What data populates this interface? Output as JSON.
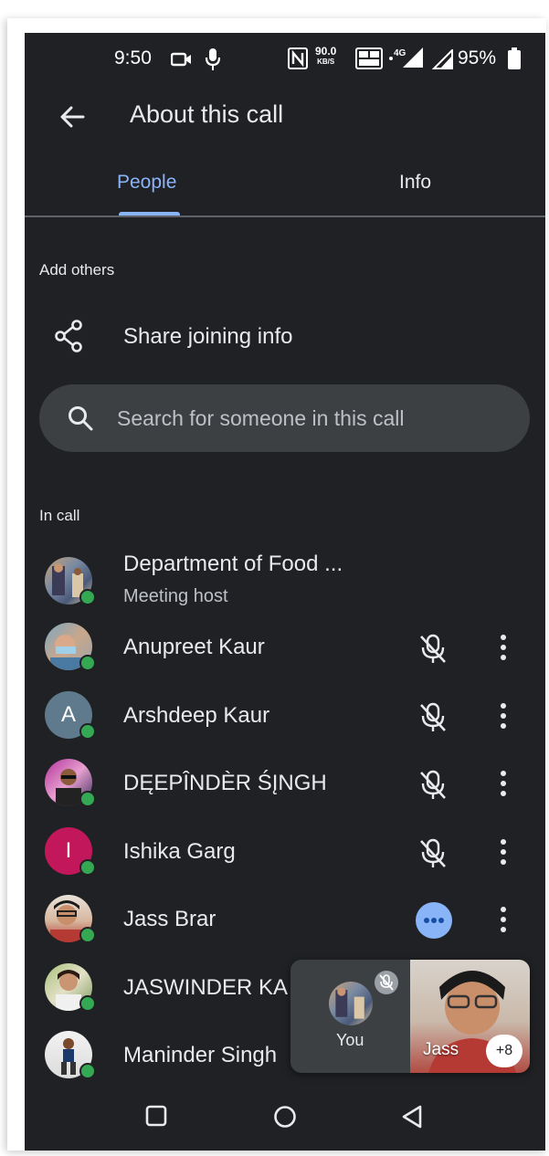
{
  "status_bar": {
    "time": "9:50",
    "speed_value": "90.0",
    "speed_unit": "KB/S",
    "battery": "95%"
  },
  "app_bar": {
    "title": "About this call"
  },
  "tabs": [
    {
      "label": "People",
      "selected": true
    },
    {
      "label": "Info",
      "selected": false
    }
  ],
  "add_others": {
    "section_label": "Add others",
    "share_label": "Share joining info"
  },
  "search": {
    "placeholder": "Search for someone in this call"
  },
  "in_call": {
    "section_label": "In call",
    "participants": [
      {
        "name": "Department of Food ...",
        "subtitle": "Meeting host"
      },
      {
        "name": "Anupreet Kaur",
        "state": "muted"
      },
      {
        "name": "Arshdeep Kaur",
        "initial": "A",
        "state": "muted"
      },
      {
        "name": "DĘEPÎNDÈR ŚĮNGH",
        "state": "muted"
      },
      {
        "name": "Ishika Garg",
        "initial": "I",
        "state": "muted"
      },
      {
        "name": "Jass Brar",
        "state": "speaking"
      },
      {
        "name": "JASWINDER KA"
      },
      {
        "name": "Maninder Singh"
      }
    ]
  },
  "pip": {
    "you_label": "You",
    "other_label": "Jass",
    "more_count": "+8"
  },
  "colors": {
    "background": "#202124",
    "accent": "#8ab4f8",
    "online": "#34a853",
    "ishika_avatar": "#c2185b",
    "arshdeep_avatar": "#5f7a8c"
  }
}
